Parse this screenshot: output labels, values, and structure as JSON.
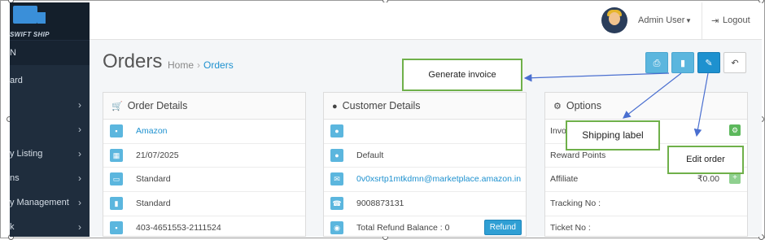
{
  "sidebar": {
    "logo_text": "SWIFT SHIP",
    "items": [
      {
        "label": "N"
      },
      {
        "label": "ard"
      },
      {
        "label": ""
      },
      {
        "label": ""
      },
      {
        "label": "y Listing"
      },
      {
        "label": "ns"
      },
      {
        "label": "y Management"
      },
      {
        "label": "k"
      }
    ]
  },
  "topbar": {
    "user_name": "Admin User",
    "logout_label": "Logout"
  },
  "page": {
    "title": "Orders",
    "breadcrumb": [
      "Home",
      "Orders"
    ]
  },
  "order_details": {
    "heading": "Order Details",
    "rows": [
      {
        "icon": "cart-icon",
        "value": "Amazon"
      },
      {
        "icon": "calendar-icon",
        "value": "21/07/2025"
      },
      {
        "icon": "credit-card-icon",
        "value": "Standard"
      },
      {
        "icon": "truck-icon",
        "value": "Standard"
      },
      {
        "icon": "cart-icon",
        "value": "403-4651553-2111524"
      }
    ]
  },
  "customer_details": {
    "heading": "Customer Details",
    "rows": [
      {
        "icon": "user-icon",
        "value": ""
      },
      {
        "icon": "users-icon",
        "value": "Default"
      },
      {
        "icon": "envelope-icon",
        "value": "0v0xsrtp1mtkdmn@marketplace.amazon.in"
      },
      {
        "icon": "phone-icon",
        "value": "9008873131"
      },
      {
        "icon": "eye-icon",
        "value": "Total Refund Balance : 0"
      }
    ],
    "refund_label": "Refund"
  },
  "options": {
    "heading": "Options",
    "rows": [
      {
        "label": "Invo"
      },
      {
        "label": "Reward Points"
      },
      {
        "label": "Affiliate",
        "value": "₹0.00"
      },
      {
        "label": "Tracking No :"
      },
      {
        "label": "Ticket No :"
      }
    ]
  },
  "callouts": {
    "generate_invoice": "Generate invoice",
    "shipping_label": "Shipping label",
    "edit_order": "Edit order"
  },
  "colors": {
    "accent": "#1e91cf",
    "light_accent": "#5bb6de",
    "callout_border": "#6fb04a",
    "sidebar": "#1f2d3d"
  }
}
